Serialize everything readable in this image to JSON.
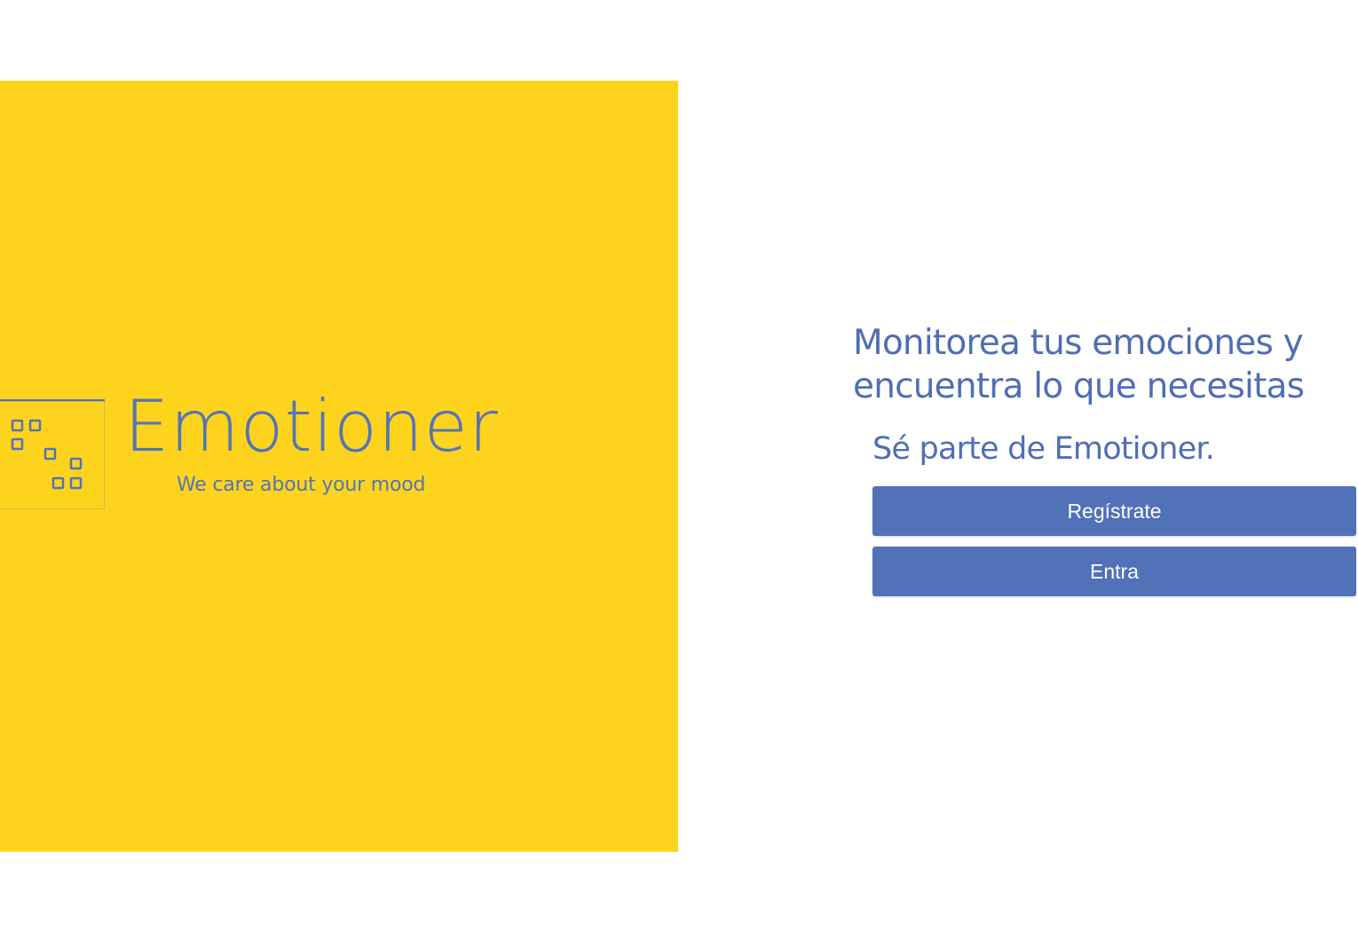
{
  "hero": {
    "background_color": "#fdd31e",
    "logo": {
      "icon": "emotioner-grid-logo-icon",
      "wordmark": "Emotioner",
      "tagline": "We care about your mood",
      "color": "#5274b8"
    }
  },
  "content": {
    "headline": "Monitorea tus emociones y encuentra lo que necesitas",
    "subheadline": "Sé parte de Emotioner.",
    "text_color": "#4f6eb4"
  },
  "actions": {
    "register_label": "Regístrate",
    "login_label": "Entra",
    "button_color": "#5171b8"
  }
}
